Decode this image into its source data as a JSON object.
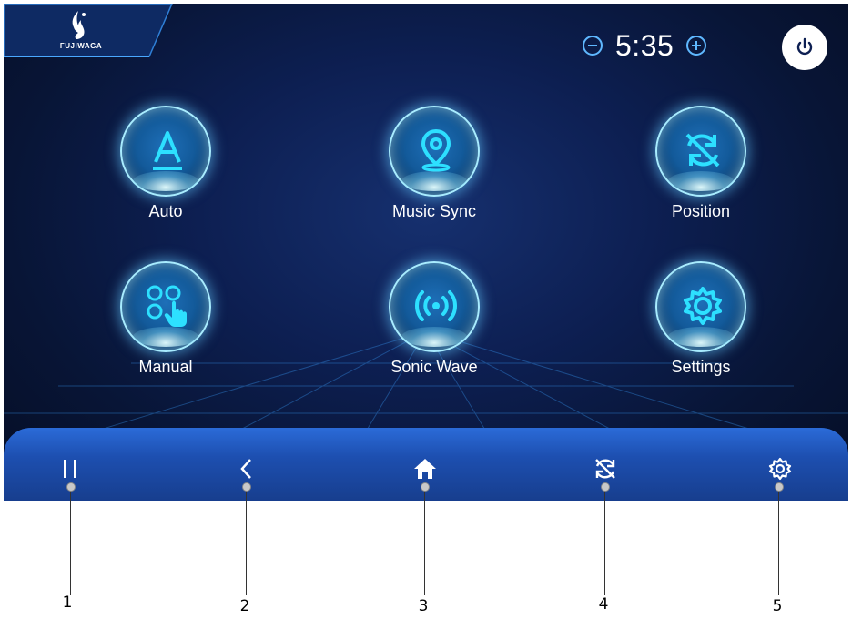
{
  "brand": {
    "logo_text": "FUJIWAGA"
  },
  "timer": {
    "value": "5:35",
    "minus_icon": "minus-circle-icon",
    "plus_icon": "plus-circle-icon"
  },
  "power": {
    "icon": "power-icon"
  },
  "modes": [
    {
      "label": "Auto",
      "icon": "letter-a-icon"
    },
    {
      "label": "Music Sync",
      "icon": "location-pin-icon"
    },
    {
      "label": "Position",
      "icon": "cycle-arrows-icon"
    },
    {
      "label": "Manual",
      "icon": "touch-hand-icon"
    },
    {
      "label": "Sonic Wave",
      "icon": "wave-signal-icon"
    },
    {
      "label": "Settings",
      "icon": "gear-icon"
    }
  ],
  "navbar": [
    {
      "icon": "pause-icon",
      "callout": "1"
    },
    {
      "icon": "back-chevron-icon",
      "callout": "2"
    },
    {
      "icon": "home-icon",
      "callout": "3"
    },
    {
      "icon": "cycle-icon",
      "callout": "4"
    },
    {
      "icon": "gear-icon",
      "callout": "5"
    }
  ],
  "colors": {
    "accent": "#5fb8ff",
    "orb_glow": "#a8ecff",
    "navbar": "#1d4fb0",
    "background": "#0d1f52"
  }
}
